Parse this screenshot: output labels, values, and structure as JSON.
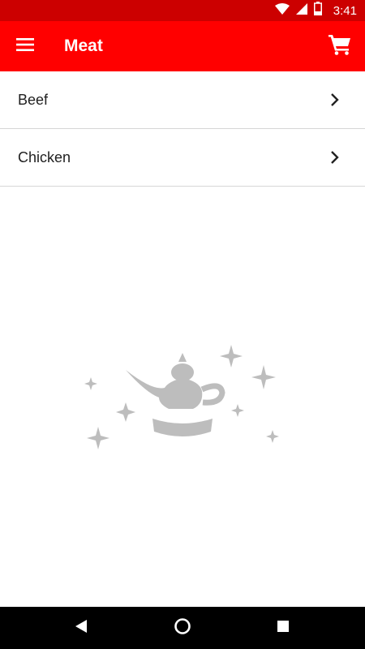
{
  "status_bar": {
    "time": "3:41",
    "icons": [
      "wifi-icon",
      "signal-icon",
      "battery-icon"
    ]
  },
  "app_bar": {
    "title": "Meat",
    "icons": [
      "menu-icon",
      "cart-icon"
    ]
  },
  "categories": [
    {
      "label": "Beef"
    },
    {
      "label": "Chicken"
    }
  ],
  "illustration": {
    "icon": "magic-lamp-icon"
  },
  "nav_bar": {
    "icons": [
      "back-icon",
      "home-icon",
      "recents-icon"
    ]
  },
  "colors": {
    "status_bar": "#cc0000",
    "app_bar": "#ff0000",
    "illustration": "#bdbdbd",
    "nav_bar": "#000000"
  }
}
